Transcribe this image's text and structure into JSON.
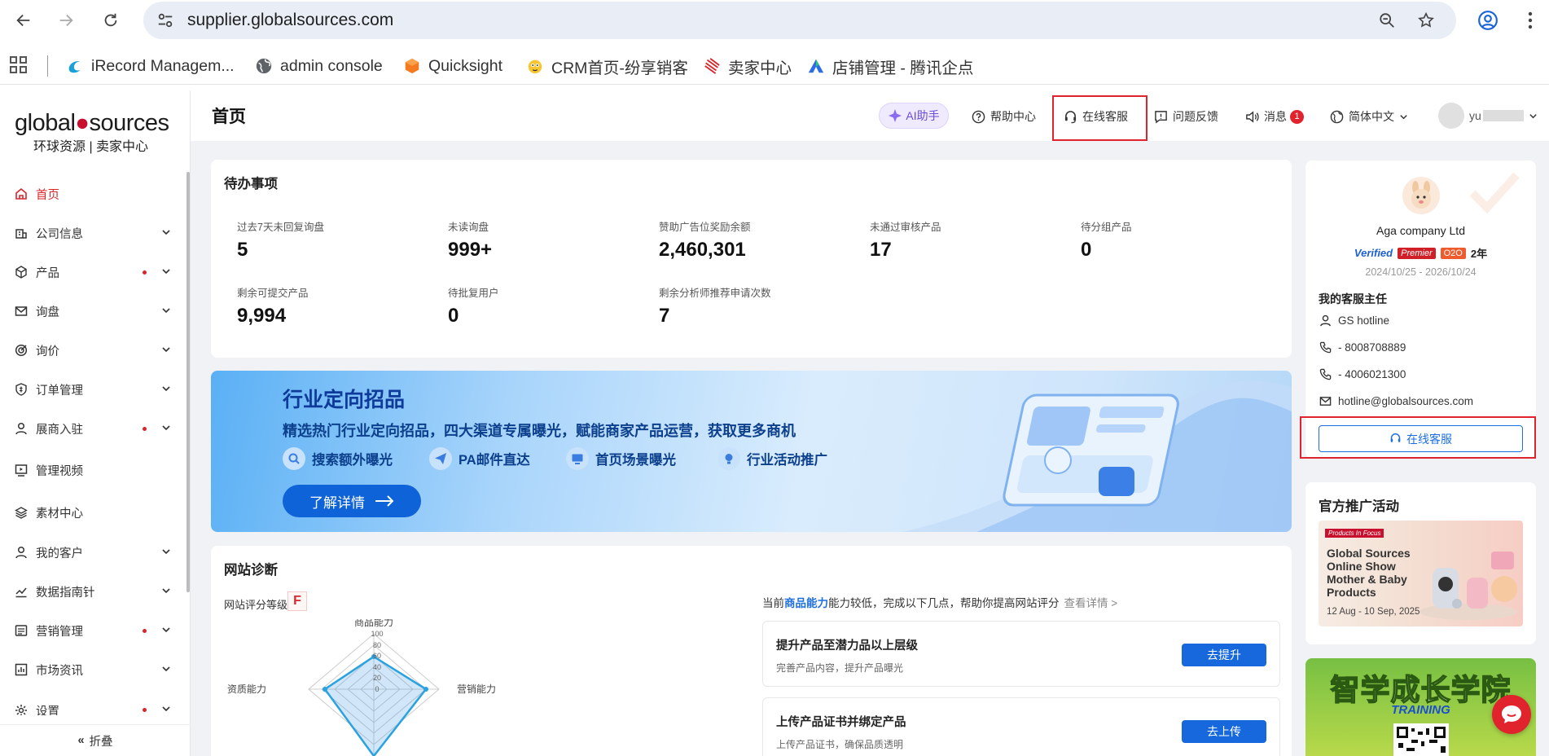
{
  "browser": {
    "url": "supplier.globalsources.com",
    "bookmarks": [
      {
        "label": "iRecord Managem...",
        "icon": "irecord-icon"
      },
      {
        "label": "admin console",
        "icon": "globe-icon"
      },
      {
        "label": "Quicksight",
        "icon": "quicksight-icon"
      },
      {
        "label": "CRM首页-纷享销客",
        "icon": "crm-icon"
      },
      {
        "label": "卖家中心",
        "icon": "seller-center-icon"
      },
      {
        "label": "店铺管理 - 腾讯企点",
        "icon": "tencent-qidian-icon"
      }
    ]
  },
  "sidebar": {
    "logo_main_a": "global",
    "logo_main_b": "sources",
    "logo_sub": "环球资源 | 卖家中心",
    "items": [
      {
        "label": "首页",
        "icon": "home-icon",
        "active": true
      },
      {
        "label": "公司信息",
        "icon": "company-icon"
      },
      {
        "label": "产品",
        "icon": "product-icon",
        "dot": true
      },
      {
        "label": "询盘",
        "icon": "mail-icon"
      },
      {
        "label": "询价",
        "icon": "target-icon"
      },
      {
        "label": "订单管理",
        "icon": "order-icon"
      },
      {
        "label": "展商入驻",
        "icon": "exhibitor-icon",
        "dot": true
      },
      {
        "label": "管理视频",
        "icon": "video-icon"
      },
      {
        "label": "素材中心",
        "icon": "layers-icon"
      },
      {
        "label": "我的客户",
        "icon": "user-icon"
      },
      {
        "label": "数据指南针",
        "icon": "chart-icon"
      },
      {
        "label": "营销管理",
        "icon": "marketing-icon",
        "dot": true
      },
      {
        "label": "市场资讯",
        "icon": "news-icon"
      },
      {
        "label": "设置",
        "icon": "settings-icon",
        "dot": true
      }
    ],
    "collapse_label": "折叠"
  },
  "header": {
    "title": "首页",
    "ai_label": "AI助手",
    "help_label": "帮助中心",
    "service_label": "在线客服",
    "feedback_label": "问题反馈",
    "messages_label": "消息",
    "messages_count": "1",
    "language_label": "简体中文",
    "user_name": "yu"
  },
  "todo": {
    "title": "待办事项",
    "stats": [
      {
        "label": "过去7天未回复询盘",
        "value": "5"
      },
      {
        "label": "未读询盘",
        "value": "999+"
      },
      {
        "label": "赞助广告位奖励余额",
        "value": "2,460,301"
      },
      {
        "label": "未通过审核产品",
        "value": "17"
      },
      {
        "label": "待分组产品",
        "value": "0"
      },
      {
        "label": "剩余可提交产品",
        "value": "9,994"
      },
      {
        "label": "待批复用户",
        "value": "0"
      },
      {
        "label": "剩余分析师推荐申请次数",
        "value": "7"
      }
    ]
  },
  "banner": {
    "title": "行业定向招品",
    "subtitle": "精选热门行业定向招品，四大渠道专属曝光，赋能商家产品运营，获取更多商机",
    "features": [
      "搜索额外曝光",
      "PA邮件直达",
      "首页场景曝光",
      "行业活动推广"
    ],
    "button_label": "了解详情"
  },
  "diagnosis": {
    "title": "网站诊断",
    "grade_label": "网站评分等级:",
    "grade": "F",
    "hint_prefix": "当前",
    "hint_highlight": "商品能力",
    "hint_suffix": "能力较低，完成以下几点，帮助你提高网站评分",
    "hint_more": "查看详情 >",
    "radar_axes": [
      "商品能力",
      "营销能力",
      "资质能力"
    ],
    "radar_ticks": [
      "100",
      "80",
      "60",
      "40",
      "20",
      "0"
    ],
    "tasks": [
      {
        "title": "提升产品至潜力品以上层级",
        "desc": "完善产品内容，提升产品曝光",
        "button": "去提升"
      },
      {
        "title": "上传产品证书并绑定产品",
        "desc": "上传产品证书，确保品质透明",
        "button": "去上传"
      }
    ]
  },
  "account": {
    "company": "Aga company Ltd",
    "verified": "Verified",
    "premier": "Premier",
    "o2o": "O2O",
    "years": "2年",
    "period": "2024/10/25 - 2026/10/24",
    "manager_title": "我的客服主任",
    "contact_name": "GS hotline",
    "phone1": "- 8008708889",
    "phone2": "- 4006021300",
    "email": "hotline@globalsources.com",
    "chat_button": "在线客服"
  },
  "promo": {
    "title": "官方推广活动",
    "tag": "Products In Focus",
    "event_title": "Global Sources Online Show Mother & Baby Products",
    "event_date": "12 Aug - 10 Sep, 2025"
  },
  "academy": {
    "title": "智学成长学院",
    "subtitle": "TRAINING"
  },
  "colors": {
    "brand_red": "#d9262c",
    "primary_blue": "#1668dc",
    "highlight_box": "#e0232c"
  }
}
